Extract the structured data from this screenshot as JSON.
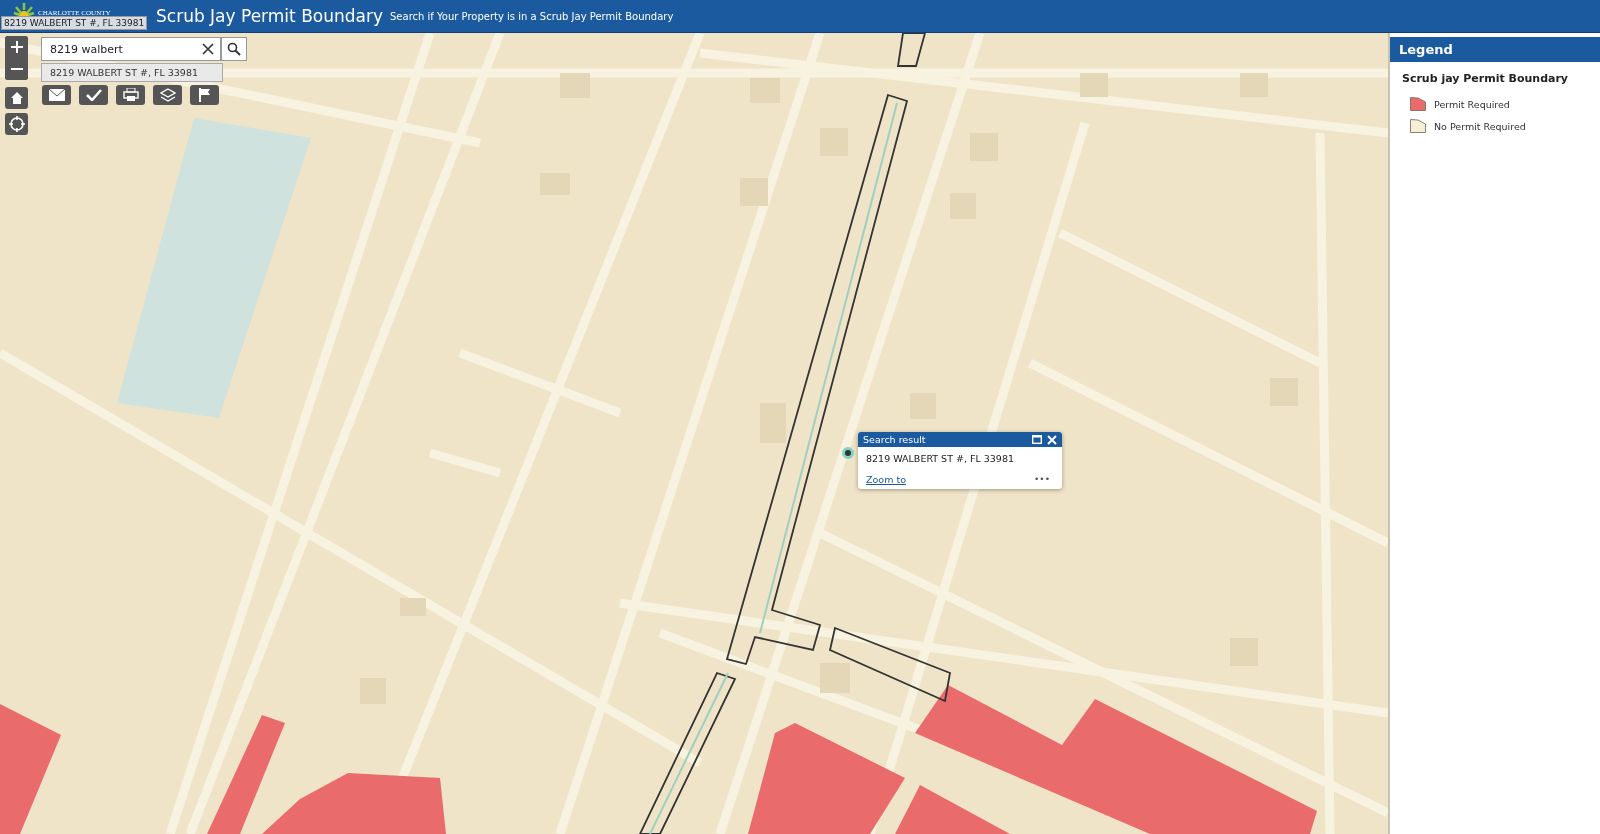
{
  "header": {
    "logo_text": "CHARLOTTE COUNTY",
    "title": "Scrub Jay Permit Boundary",
    "subtitle": "Search if Your Property is in a Scrub Jay Permit Boundary"
  },
  "tooltip": "8219 WALBERT ST #, FL 33981",
  "search": {
    "value": "8219 walbert",
    "suggestions": [
      "8219 WALBERT ST #, FL 33981"
    ]
  },
  "popup": {
    "title": "Search result",
    "address": "8219 WALBERT ST #, FL 33981",
    "link": "Zoom to",
    "more": "•••"
  },
  "legend": {
    "title": "Legend",
    "layer": "Scrub jay Permit Boundary",
    "items": [
      {
        "label": "Permit Required",
        "color": "#ea6b6b"
      },
      {
        "label": "No Permit Required",
        "color": "#f6efd6"
      }
    ]
  }
}
